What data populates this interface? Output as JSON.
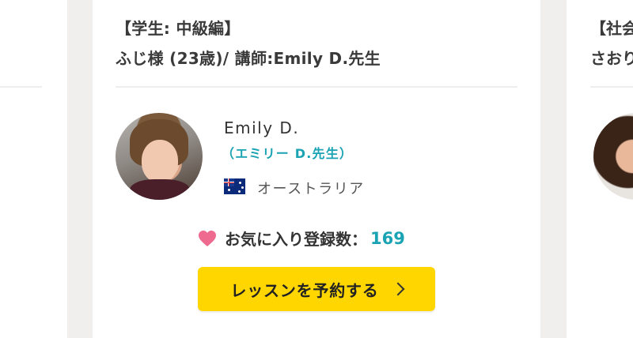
{
  "main_card": {
    "category_title": "【学生: 中級編】",
    "student_line": "ふじ様 (23歳)/ 講師:Emily D.先生",
    "teacher": {
      "name": "Emily D.",
      "name_ja": "（エミリー D.先生）",
      "country": "オーストラリア",
      "flag_icon": "australia-flag-icon"
    },
    "favorites": {
      "label": "お気に入り登録数：",
      "count": "169",
      "icon": "heart-icon"
    },
    "reserve_button": {
      "label": "レッスンを予約する",
      "icon": "chevron-right-icon"
    }
  },
  "right_card": {
    "category_title": "【社会",
    "student_line": "さおり"
  },
  "colors": {
    "accent": "#1aa3b3",
    "button": "#ffd600",
    "heart": "#ef6a8f",
    "background": "#f0efed"
  }
}
